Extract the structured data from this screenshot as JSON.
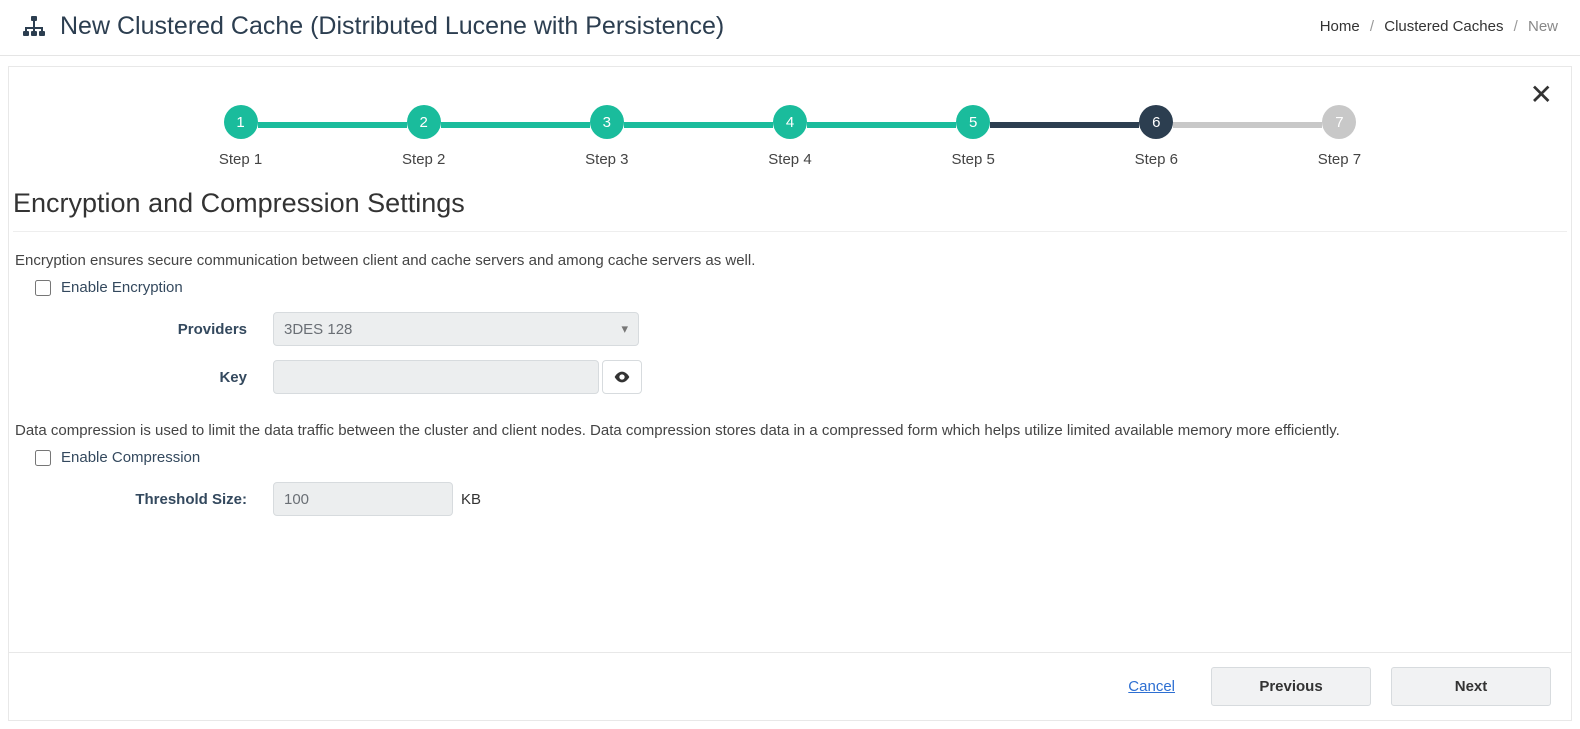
{
  "header": {
    "title": "New Clustered Cache (Distributed Lucene with Persistence)"
  },
  "breadcrumb": {
    "home": "Home",
    "clustered": "Clustered Caches",
    "current": "New"
  },
  "stepper": {
    "steps": [
      {
        "num": "1",
        "label": "Step 1",
        "state": "done",
        "line": "done"
      },
      {
        "num": "2",
        "label": "Step 2",
        "state": "done",
        "line": "done"
      },
      {
        "num": "3",
        "label": "Step 3",
        "state": "done",
        "line": "done"
      },
      {
        "num": "4",
        "label": "Step 4",
        "state": "done",
        "line": "done"
      },
      {
        "num": "5",
        "label": "Step 5",
        "state": "done",
        "line": "active"
      },
      {
        "num": "6",
        "label": "Step 6",
        "state": "active",
        "line": "pending"
      },
      {
        "num": "7",
        "label": "Step 7",
        "state": "pending",
        "line": ""
      }
    ]
  },
  "section": {
    "title": "Encryption and Compression Settings"
  },
  "encryption": {
    "description": "Encryption ensures secure communication between client and cache servers and among cache servers as well.",
    "enable_label": "Enable Encryption",
    "providers_label": "Providers",
    "providers_value": "3DES 128",
    "key_label": "Key",
    "key_value": ""
  },
  "compression": {
    "description": "Data compression is used to limit the data traffic between the cluster and client nodes. Data compression stores data in a compressed form which helps utilize limited available memory more efficiently.",
    "enable_label": "Enable Compression",
    "threshold_label": "Threshold Size:",
    "threshold_value": "100",
    "threshold_unit": "KB"
  },
  "footer": {
    "cancel": "Cancel",
    "previous": "Previous",
    "next": "Next"
  }
}
